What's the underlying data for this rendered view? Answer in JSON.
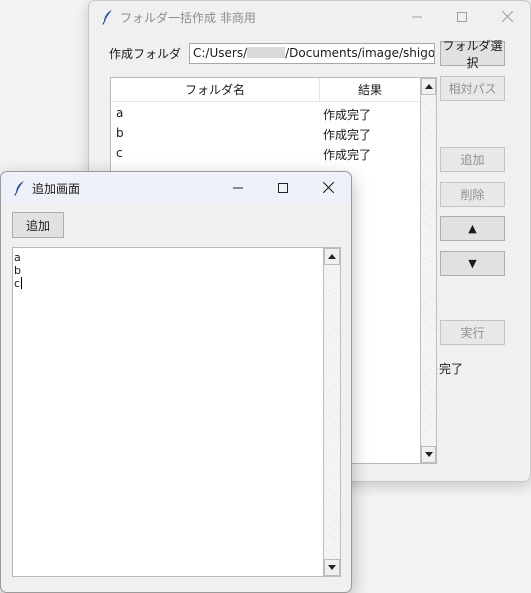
{
  "main_window": {
    "title": "フォルダ一括作成 非商用",
    "folder_label": "作成フォルダ",
    "path_prefix": "C:/Users/",
    "path_suffix": "/Documents/image/shigotan",
    "select_folder_button": "フォルダ選択",
    "relative_path_button": "相対パス",
    "table": {
      "columns": [
        "フォルダ名",
        "結果"
      ],
      "rows": [
        {
          "name": "a",
          "result": "作成完了"
        },
        {
          "name": "b",
          "result": "作成完了"
        },
        {
          "name": "c",
          "result": "作成完了"
        }
      ]
    },
    "add_button": "追加",
    "delete_button": "削除",
    "up_button": "▲",
    "down_button": "▼",
    "run_button": "実行",
    "status_text": "完了"
  },
  "dialog": {
    "title": "追加画面",
    "add_button": "追加",
    "text_lines": [
      "a",
      "b",
      "c"
    ]
  },
  "icons": {
    "app": "feather-icon",
    "minimize": "minimize-icon",
    "maximize": "maximize-icon",
    "close": "close-icon",
    "scroll_up": "scroll-up-arrow-icon",
    "scroll_down": "scroll-down-arrow-icon"
  },
  "colors": {
    "titlebar_active": "#eef2f8",
    "window_bg": "#f0f0f0",
    "disabled_text": "#8f8f8f"
  }
}
